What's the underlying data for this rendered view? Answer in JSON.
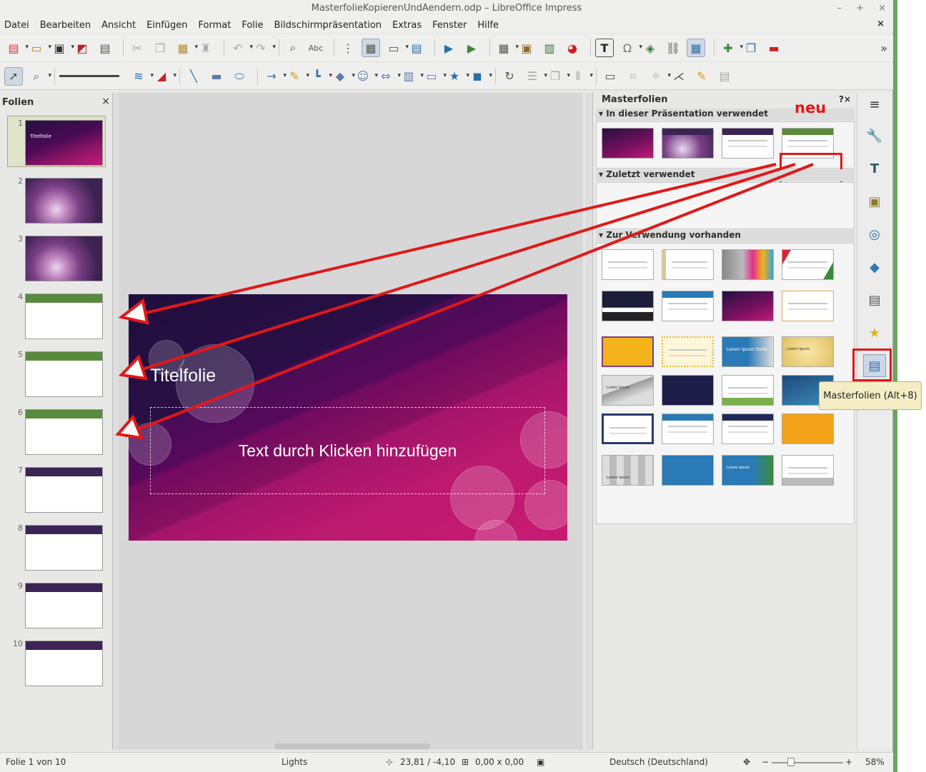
{
  "window": {
    "title": "MasterfolieKopierenUndAendern.odp – LibreOffice Impress",
    "controls": [
      "–",
      "+",
      "×"
    ]
  },
  "menu": [
    "Datei",
    "Bearbeiten",
    "Ansicht",
    "Einfügen",
    "Format",
    "Folie",
    "Bildschirmpräsentation",
    "Extras",
    "Fenster",
    "Hilfe"
  ],
  "menu_close": "×",
  "toolbar1_icons": [
    "new-icon",
    "open-icon",
    "save-icon",
    "export-pdf-icon",
    "print-icon",
    "cut-icon",
    "copy-icon",
    "paste-icon",
    "clone-formatting-icon",
    "undo-icon",
    "redo-icon",
    "find-replace-icon",
    "spellcheck-icon",
    "grid-icon",
    "helplines-icon",
    "display-views-icon",
    "master-slide-icon",
    "start-presentation-icon",
    "presentation-current-icon",
    "table-icon",
    "image-icon",
    "media-icon",
    "chart-icon",
    "textbox-icon",
    "special-character-icon",
    "fontwork-icon",
    "hyperlink-icon",
    "layout-icon",
    "new-slide-icon",
    "duplicate-slide-icon",
    "delete-slide-icon"
  ],
  "toolbar1_abc": "Abc",
  "toolbar1_text_icon": "T",
  "toolbar1_more": "»",
  "slides_pane": {
    "title": "Folien",
    "close": "×",
    "slides": [
      {
        "num": "1",
        "kind": "title",
        "mini_title": "Titelfolie"
      },
      {
        "num": "2",
        "kind": "bokeh"
      },
      {
        "num": "3",
        "kind": "bokeh"
      },
      {
        "num": "4",
        "kind": "green"
      },
      {
        "num": "5",
        "kind": "green"
      },
      {
        "num": "6",
        "kind": "green"
      },
      {
        "num": "7",
        "kind": "purple"
      },
      {
        "num": "8",
        "kind": "purple"
      },
      {
        "num": "9",
        "kind": "purple"
      },
      {
        "num": "10",
        "kind": "purple"
      }
    ]
  },
  "slide": {
    "title": "Titelfolie",
    "body_placeholder": "Text durch Klicken hinzufügen"
  },
  "master_panel": {
    "title": "Masterfolien",
    "controls": "?×",
    "sections": {
      "used": "In dieser Präsentation verwendet",
      "recent": "Zuletzt verwendet",
      "available": "Zur Verwendung vorhanden"
    },
    "new_label": "neu",
    "available_labels": [
      "Lorem Ipsum",
      "Lorem Ipsum Dolor",
      "Lorem Ipsum",
      "Lorem Ipsum",
      "Lorem Ipsum"
    ]
  },
  "tooltip": "Masterfolien (Alt+8)",
  "statusbar": {
    "slide_info": "Folie 1 von 10",
    "master_name": "Lights",
    "position": "23,81 / -4,10",
    "size": "0,00 x 0,00",
    "language": "Deutsch (Deutschland)",
    "zoom": "58%",
    "zoom_minus": "−",
    "zoom_plus": "+"
  },
  "colors": {
    "annotation_red": "#e21818",
    "green_master": "#5a8a3c",
    "purple_master": "#3b2455",
    "selection_bg": "#dfe3c8"
  }
}
